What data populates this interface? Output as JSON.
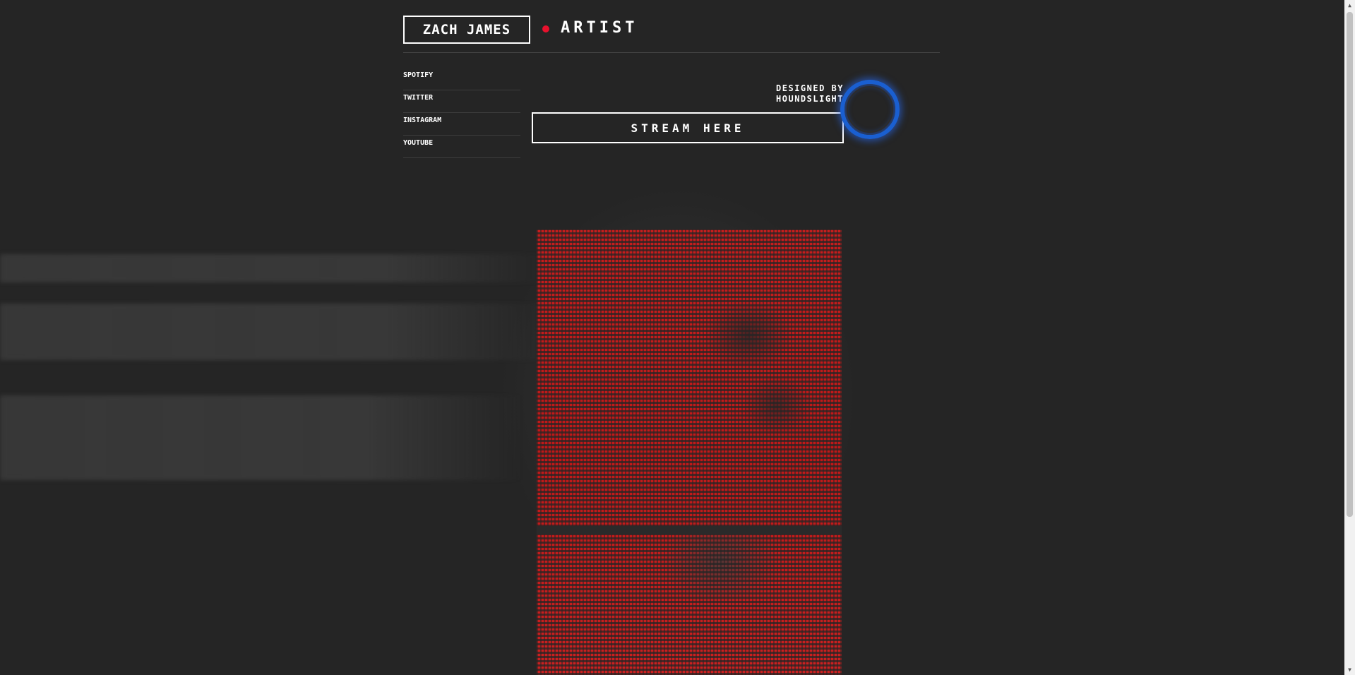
{
  "header": {
    "logo": "ZACH JAMES",
    "role": "ARTIST",
    "accent_color": "#e8112d"
  },
  "social_links": [
    {
      "label": "SPOTIFY"
    },
    {
      "label": "TWITTER"
    },
    {
      "label": "INSTAGRAM"
    },
    {
      "label": "YOUTUBE"
    }
  ],
  "credit": {
    "line1": "DESIGNED BY",
    "line2": "HOUNDSLIGHT"
  },
  "stream_button": {
    "label": "STREAM HERE"
  },
  "ring_color": "#1a5fd0",
  "scrollbar": {
    "up": "▲",
    "down": "▼"
  }
}
